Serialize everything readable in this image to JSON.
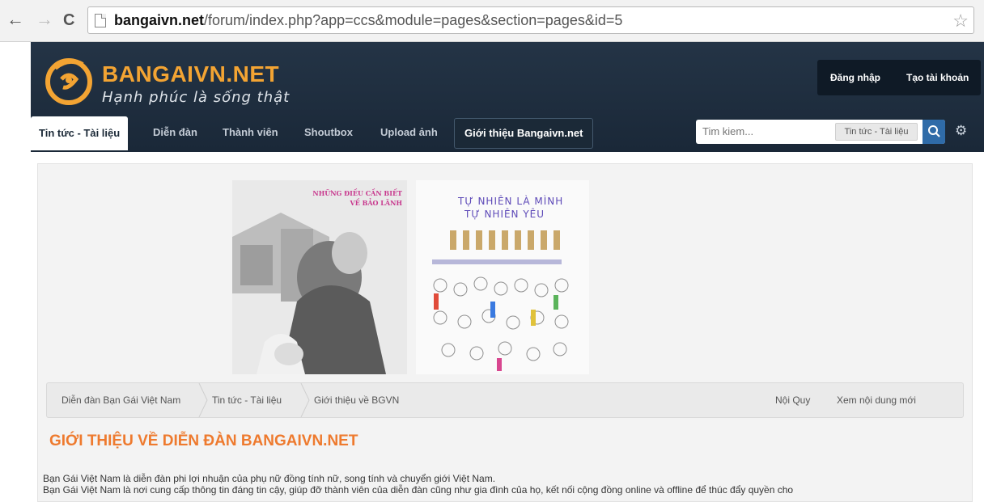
{
  "browser": {
    "url_host": "bangaivn.net",
    "url_path": "/forum/index.php?app=ccs&module=pages&section=pages&id=5"
  },
  "header": {
    "logo_text": "BANGAIVN.NET",
    "tagline": "Hạnh phúc là sống thật",
    "login_label": "Đăng nhập",
    "register_label": "Tạo tài khoản"
  },
  "nav": {
    "tabs": [
      {
        "label": "Tin tức - Tài liệu"
      },
      {
        "label": "Diễn đàn"
      },
      {
        "label": "Thành viên"
      },
      {
        "label": "Shoutbox"
      },
      {
        "label": "Upload ảnh"
      },
      {
        "label": "Giới thiệu Bangaivn.net"
      }
    ],
    "search_placeholder": "Tim kiem...",
    "search_scope": "Tin tức - Tài liệu"
  },
  "banners": {
    "left_caption": [
      "NHỮNG ĐIỀU CẦN BIẾT",
      "VỀ BẢO LÃNH"
    ],
    "right_title": [
      "TỰ NHIÊN LÀ MÌNH",
      "TỰ NHIÊN YÊU"
    ]
  },
  "breadcrumb": {
    "items": [
      "Diễn đàn Bạn Gái Việt Nam",
      "Tin tức - Tài liệu",
      "Giới thiệu về BGVN"
    ],
    "right_links": [
      "Nội Quy",
      "Xem nội dung mới"
    ]
  },
  "article": {
    "title": "GIỚI THIỆU VỀ DIỄN ĐÀN BANGAIVN.NET",
    "line1": "Bạn Gái Việt Nam là diễn đàn phi lợi nhuận của phụ nữ đồng tính nữ, song tính và chuyển giới Việt Nam.",
    "line2": "Bạn Gái Việt Nam là nơi cung cấp thông tin đáng tin cậy, giúp đỡ thành viên của diễn đàn cũng như gia đình của họ, kết nối cộng đồng online và offline để thúc đẩy quyền cho"
  },
  "colors": {
    "header_bg": "#1e2d3d",
    "accent_orange": "#ee7a2e",
    "logo_orange": "#f3a433"
  },
  "icons": [
    "back-icon",
    "forward-icon",
    "reload-icon",
    "page-icon",
    "star-icon",
    "search-icon",
    "gear-icon"
  ]
}
